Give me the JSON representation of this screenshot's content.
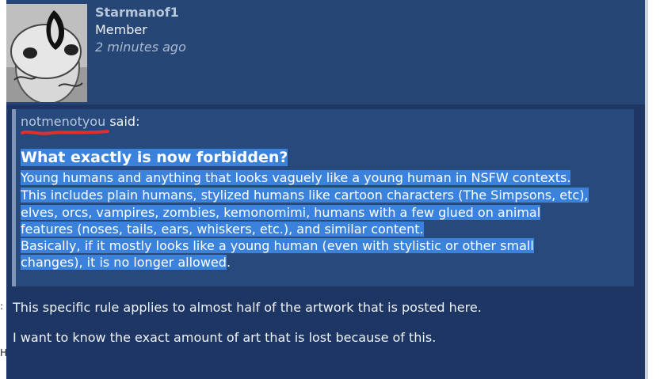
{
  "post": {
    "username": "Starmanof1",
    "role": "Member",
    "time": "2 minutes ago"
  },
  "quote": {
    "author": "notmenotyou",
    "said": " said:",
    "heading": "What exactly is now forbidden?",
    "lines": [
      "Young humans and anything that looks vaguely like a young human in NSFW contexts.",
      "This includes plain humans, stylized humans like cartoon characters (The Simpsons, etc),",
      "elves, orcs, vampires, zombies, kemonomimi, humans with a few glued on animal",
      "features (noses, tails, ears, whiskers, etc.), and similar content.",
      "Basically, if it mostly looks like a young human (even with stylistic or other small",
      "changes), it is no longer allowed"
    ],
    "trailing": "."
  },
  "body": {
    "paragraphs": [
      "This specific rule applies to almost half of the artwork that is posted here.",
      "I want to know the exact amount of art that is lost because of this."
    ]
  },
  "edge_ticks": [
    ":",
    "H"
  ]
}
